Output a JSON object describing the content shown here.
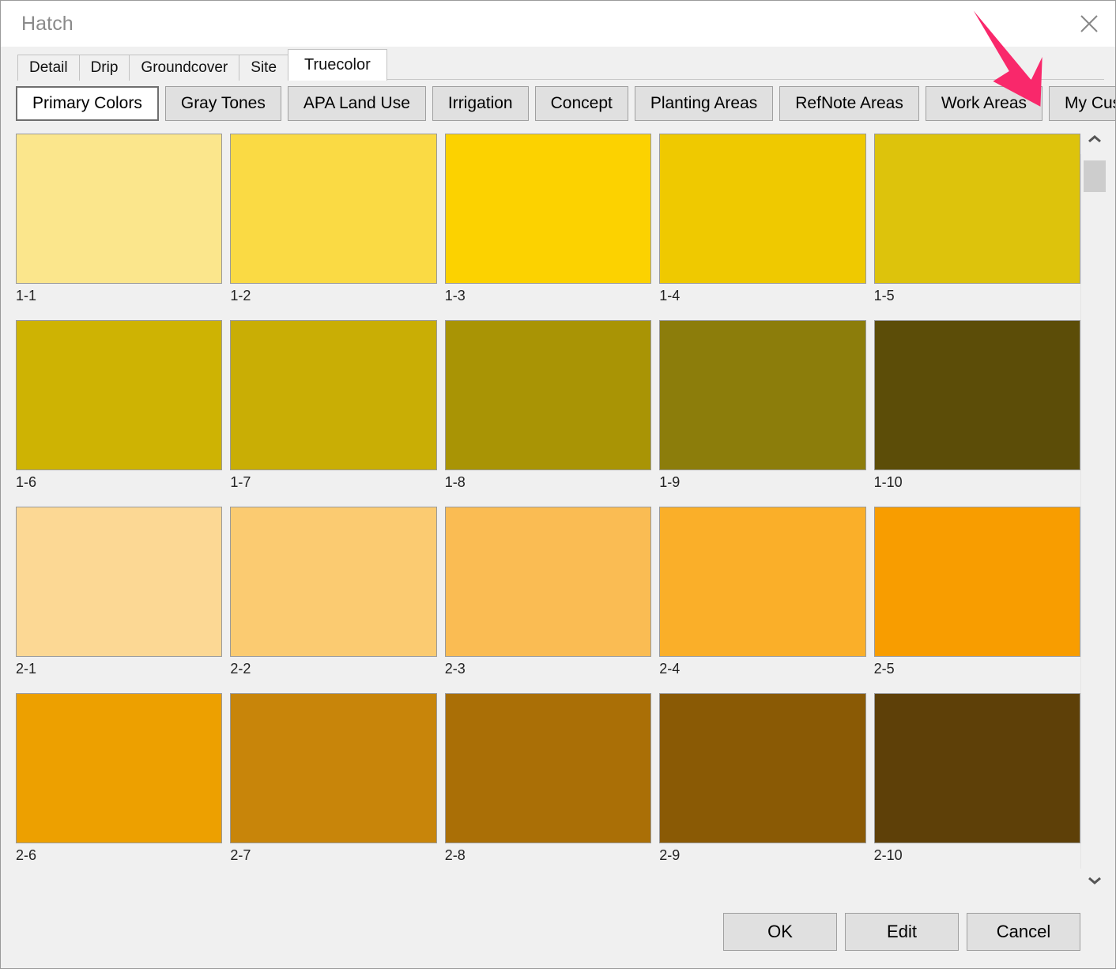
{
  "window": {
    "title": "Hatch",
    "close_icon": "close-x-icon"
  },
  "outer_tabs": [
    {
      "label": "Detail",
      "active": false
    },
    {
      "label": "Drip",
      "active": false
    },
    {
      "label": "Groundcover",
      "active": false
    },
    {
      "label": "Site",
      "active": false
    },
    {
      "label": "Truecolor",
      "active": true
    }
  ],
  "inner_tabs": [
    {
      "label": "Primary Colors",
      "active": true
    },
    {
      "label": "Gray Tones",
      "active": false
    },
    {
      "label": "APA Land Use",
      "active": false
    },
    {
      "label": "Irrigation",
      "active": false
    },
    {
      "label": "Concept",
      "active": false
    },
    {
      "label": "Planting Areas",
      "active": false
    },
    {
      "label": "RefNote Areas",
      "active": false
    },
    {
      "label": "Work Areas",
      "active": false
    },
    {
      "label": "My Custom Whe",
      "active": false
    }
  ],
  "swatches": [
    {
      "label": "1-1",
      "color": "#fbe68c"
    },
    {
      "label": "1-2",
      "color": "#fada44"
    },
    {
      "label": "1-3",
      "color": "#fcd200"
    },
    {
      "label": "1-4",
      "color": "#efc900"
    },
    {
      "label": "1-5",
      "color": "#ddc30c"
    },
    {
      "label": "1-6",
      "color": "#ceb303"
    },
    {
      "label": "1-7",
      "color": "#c9ae05"
    },
    {
      "label": "1-8",
      "color": "#a99405"
    },
    {
      "label": "1-9",
      "color": "#8c7d0b"
    },
    {
      "label": "1-10",
      "color": "#5c4d08"
    },
    {
      "label": "2-1",
      "color": "#fcd894"
    },
    {
      "label": "2-2",
      "color": "#fbcb71"
    },
    {
      "label": "2-3",
      "color": "#fabc53"
    },
    {
      "label": "2-4",
      "color": "#faaf29"
    },
    {
      "label": "2-5",
      "color": "#f89d00"
    },
    {
      "label": "2-6",
      "color": "#eda000"
    },
    {
      "label": "2-7",
      "color": "#c8850a"
    },
    {
      "label": "2-8",
      "color": "#aa6f06"
    },
    {
      "label": "2-9",
      "color": "#8a5a05"
    },
    {
      "label": "2-10",
      "color": "#5e4008"
    }
  ],
  "scrollbar": {
    "up_icon": "chevron-up-icon",
    "down_icon": "chevron-down-icon"
  },
  "footer": {
    "ok_label": "OK",
    "edit_label": "Edit",
    "cancel_label": "Cancel"
  },
  "annotation": {
    "type": "arrow-pointer",
    "color": "#f9286b",
    "points_to": "My Custom Whe"
  }
}
